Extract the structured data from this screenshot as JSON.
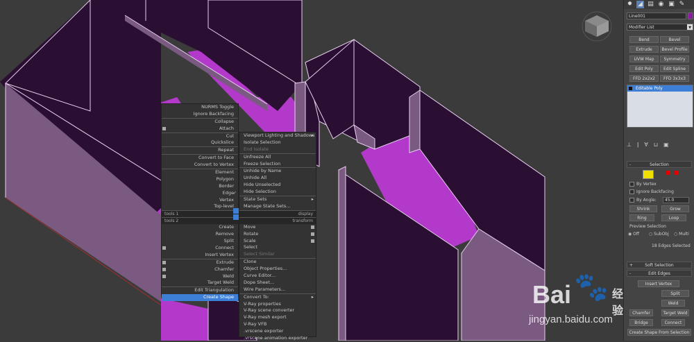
{
  "quad_left": {
    "items": [
      "NURMS Toggle",
      "Ignore Backfacing",
      "Collapse",
      "Attach",
      "Cut",
      "Quickslice",
      "Repeat",
      "Convert to Face",
      "Convert to Vertex",
      "Element",
      "Polygon",
      "Border",
      "Edge",
      "Vertex",
      "Top-level"
    ],
    "header1_left": "tools 1",
    "header2_left": "tools 2",
    "tools2": [
      "Create",
      "Remove",
      "Split",
      "Connect",
      "Insert Vertex",
      "Extrude",
      "Chamfer",
      "Weld",
      "Target Weld",
      "Edit Triangulation",
      "Create Shape"
    ]
  },
  "quad_right": {
    "items": [
      "Viewport Lighting and Shadows",
      "Isolate Selection",
      "End Isolate",
      "Unfreeze All",
      "Freeze Selection",
      "Unhide by Name",
      "Unhide All",
      "Hide Unselected",
      "Hide Selection",
      "State Sets",
      "Manage State Sets..."
    ],
    "header1_right": "display",
    "header2_right": "transform",
    "transform": [
      "Move",
      "Rotate",
      "Scale",
      "Select",
      "Select Similar",
      "Clone",
      "Object Properties...",
      "Curve Editor...",
      "Dope Sheet...",
      "Wire Parameters...",
      "Convert To:",
      "V-Ray properties",
      "V-Ray scene converter",
      "V-Ray mesh export",
      "V-Ray VFB",
      ".vrscene exporter",
      ".vrscene animation exporter"
    ]
  },
  "panel": {
    "object_name": "Line001",
    "modifier_list": "Modifier List",
    "buttons": [
      "Bend",
      "Bevel",
      "Extrude",
      "Bevel Profile",
      "UVW Map",
      "Symmetry",
      "Edit Poly",
      "Edit Spline",
      "FFD 2x2x2",
      "FFD 3x3x3"
    ],
    "stack_item": "Editable Poly",
    "selection_header": "Selection",
    "by_vertex": "By Vertex",
    "ignore_backfacing": "Ignore Backfacing",
    "by_angle": "By Angle:",
    "angle_value": "45.0",
    "shrink": "Shrink",
    "grow": "Grow",
    "ring": "Ring",
    "loop": "Loop",
    "preview_selection": "Preview Selection",
    "off": "Off",
    "subobj": "SubObj",
    "multi": "Multi",
    "status": "18 Edges Selected",
    "soft_selection": "Soft Selection",
    "edit_edges": "Edit Edges",
    "insert_vertex": "Insert Vertex",
    "split": "Split",
    "weld": "Weld",
    "chamfer": "Chamfer",
    "target_weld": "Target Weld",
    "bridge": "Bridge",
    "connect": "Connect",
    "create_shape": "Create Shape From Selection"
  },
  "watermark": {
    "brand": "Bai",
    "brand2": "经验",
    "url": "jingyan.baidu.com"
  },
  "colors": {
    "magenta": "#b239c9",
    "dark_purple": "#2a0f33",
    "highlight": "#3d7ed6"
  }
}
